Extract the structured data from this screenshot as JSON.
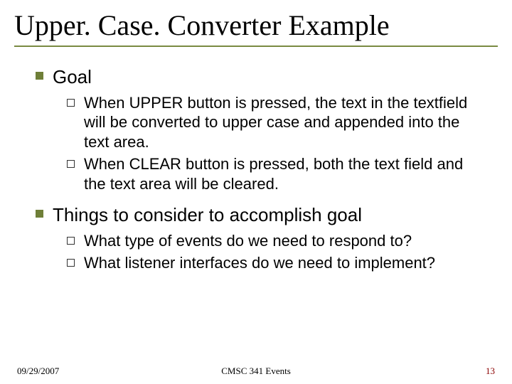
{
  "title": "Upper. Case. Converter Example",
  "sections": [
    {
      "heading": "Goal",
      "items": [
        "When UPPER button is pressed, the text in the textfield will be converted to upper case and appended into the text area.",
        "When CLEAR button is pressed, both the text field and the text area will be cleared."
      ]
    },
    {
      "heading": "Things to consider to accomplish goal",
      "items": [
        "What type of events do we need to respond to?",
        "What listener interfaces do we need to implement?"
      ]
    }
  ],
  "footer": {
    "date": "09/29/2007",
    "center": "CMSC 341 Events",
    "page": "13"
  }
}
